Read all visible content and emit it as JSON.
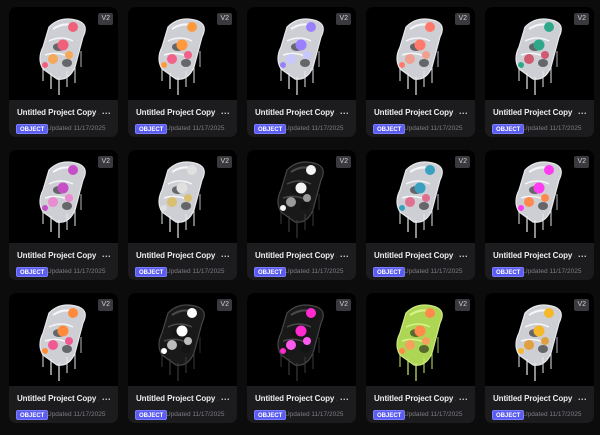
{
  "cards": [
    {
      "title": "Untitled Project Copy ...",
      "badge": "V2",
      "tag": "OBJECT",
      "updated": "Updated 11/17/2025",
      "more": "...",
      "style": "white",
      "accent": "#f0607a",
      "accent2": "#f6a85a"
    },
    {
      "title": "Untitled Project Copy ...",
      "badge": "V2",
      "tag": "OBJECT",
      "updated": "Updated 11/17/2025",
      "more": "...",
      "style": "white",
      "accent": "#ff9a3c",
      "accent2": "#f3608a"
    },
    {
      "title": "Untitled Project Copy ...",
      "badge": "V2",
      "tag": "OBJECT",
      "updated": "Updated 11/17/2025",
      "more": "...",
      "style": "white",
      "accent": "#9a80ff",
      "accent2": "#c8c8ff"
    },
    {
      "title": "Untitled Project Copy ...",
      "badge": "V2",
      "tag": "OBJECT",
      "updated": "Updated 11/17/2025",
      "more": "...",
      "style": "white",
      "accent": "#ff7a6a",
      "accent2": "#f0a090"
    },
    {
      "title": "Untitled Project Copy ...",
      "badge": "V2",
      "tag": "OBJECT",
      "updated": "Updated 11/17/2025",
      "more": "...",
      "style": "white",
      "accent": "#2fa88a",
      "accent2": "#d05a70"
    },
    {
      "title": "Untitled Project Copy ...",
      "badge": "V2",
      "tag": "OBJECT",
      "updated": "Updated 11/17/2025",
      "more": "...",
      "style": "white",
      "accent": "#c64fc8",
      "accent2": "#e98cd0"
    },
    {
      "title": "Untitled Project Copy ...",
      "badge": "V2",
      "tag": "OBJECT",
      "updated": "Updated 11/17/2025",
      "more": "...",
      "style": "white",
      "accent": "#e0e0e0",
      "accent2": "#d9c070"
    },
    {
      "title": "Untitled Project Copy ...",
      "badge": "V2",
      "tag": "OBJECT",
      "updated": "Updated 11/17/2025",
      "more": "...",
      "style": "dark",
      "accent": "#f4f4f4",
      "accent2": "#9a9a9a"
    },
    {
      "title": "Untitled Project Copy ...",
      "badge": "V2",
      "tag": "OBJECT",
      "updated": "Updated 11/17/2025",
      "more": "...",
      "style": "white",
      "accent": "#3aa0c0",
      "accent2": "#e07090"
    },
    {
      "title": "Untitled Project Copy ...",
      "badge": "V2",
      "tag": "OBJECT",
      "updated": "Updated 11/17/2025",
      "more": "...",
      "style": "white",
      "accent": "#ff3cf0",
      "accent2": "#ff8a50"
    },
    {
      "title": "Untitled Project Copy ...",
      "badge": "V2",
      "tag": "OBJECT",
      "updated": "Updated 11/17/2025",
      "more": "...",
      "style": "white",
      "accent": "#ff8a3a",
      "accent2": "#f05a90"
    },
    {
      "title": "Untitled Project Copy ...",
      "badge": "V2",
      "tag": "OBJECT",
      "updated": "Updated 11/17/2025",
      "more": "...",
      "style": "dark",
      "accent": "#ffffff",
      "accent2": "#bdbdbd"
    },
    {
      "title": "Untitled Project Copy ...",
      "badge": "V2",
      "tag": "OBJECT",
      "updated": "Updated 11/17/2025",
      "more": "...",
      "style": "dark",
      "accent": "#ff2ad0",
      "accent2": "#ff5af0"
    },
    {
      "title": "Untitled Project Copy ...",
      "badge": "V2",
      "tag": "OBJECT",
      "updated": "Updated 11/17/2025",
      "more": "...",
      "style": "lime",
      "accent": "#ff8a4a",
      "accent2": "#f6a060"
    },
    {
      "title": "Untitled Project Copy ...",
      "badge": "V2",
      "tag": "OBJECT",
      "updated": "Updated 11/17/2025",
      "more": "...",
      "style": "white",
      "accent": "#f4b82a",
      "accent2": "#e0a040"
    }
  ]
}
